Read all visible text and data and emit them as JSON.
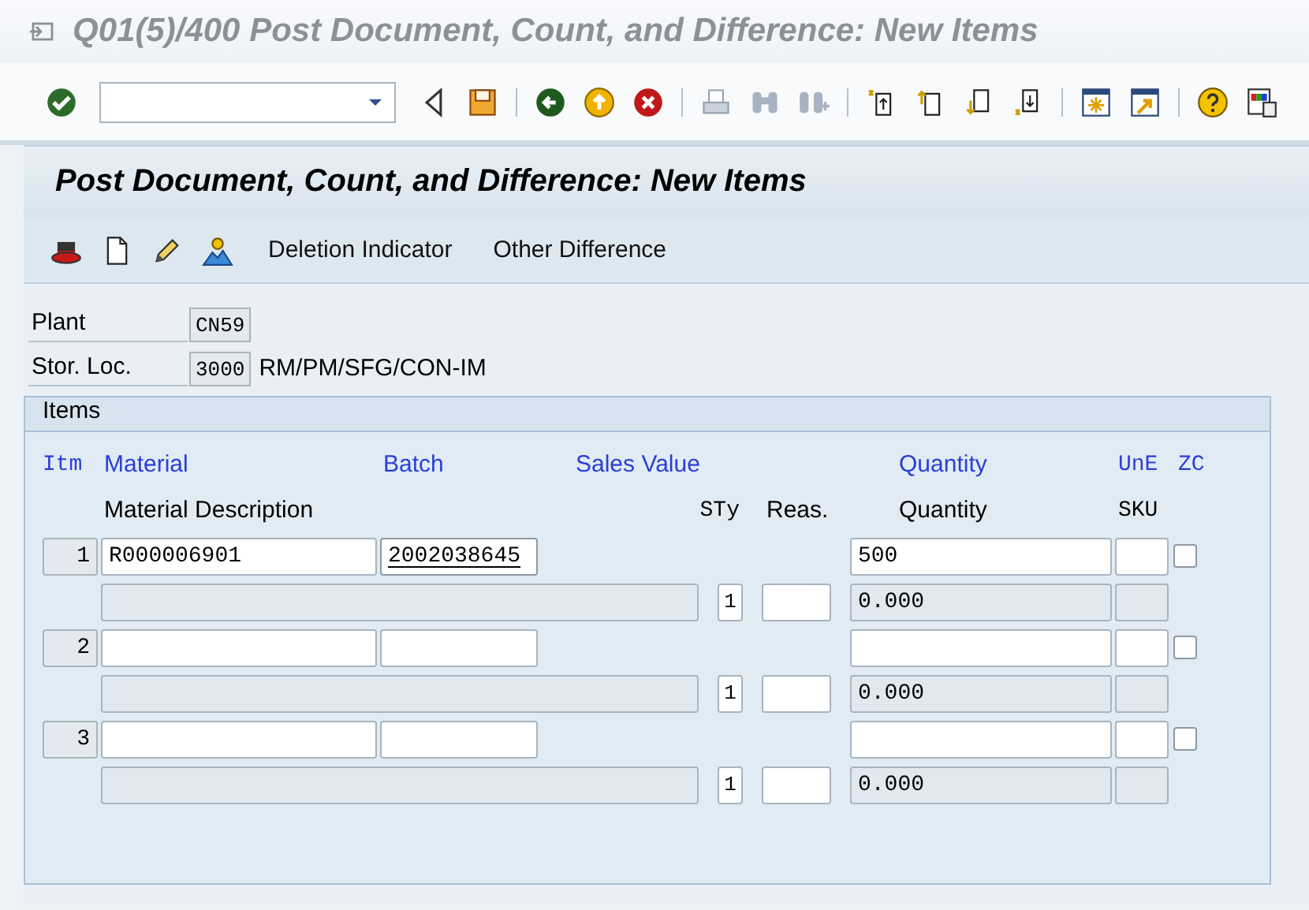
{
  "window": {
    "title": "Q01(5)/400 Post Document, Count, and Difference: New Items"
  },
  "screen": {
    "title": "Post Document, Count, and Difference: New Items"
  },
  "app_toolbar": {
    "buttons": [
      "Deletion Indicator",
      "Other Difference"
    ]
  },
  "header_fields": [
    {
      "label": "Plant",
      "value": "CN59"
    },
    {
      "label": "Stor. Loc.",
      "value": "3000",
      "description": "RM/PM/SFG/CON-IM"
    }
  ],
  "items": {
    "title": "Items",
    "columns_top": [
      "Itm",
      "Material",
      "Batch",
      "Sales Value",
      "Quantity",
      "UnE",
      "ZC"
    ],
    "columns_bottom": [
      "Material Description",
      "STy",
      "Reas.",
      "Quantity",
      "SKU"
    ],
    "rows": [
      {
        "item": "1",
        "material": "R000006901",
        "batch": "2002038645",
        "batch_focused": true,
        "quantity": "500",
        "stock_type": "1",
        "quantity_sku": "0.000",
        "zero_count": false
      },
      {
        "item": "2",
        "batch_focused": false,
        "stock_type": "1",
        "quantity_sku": "0.000",
        "zero_count": false
      },
      {
        "item": "3",
        "batch_focused": false,
        "stock_type": "1",
        "quantity_sku": "0.000",
        "zero_count": false
      }
    ]
  }
}
